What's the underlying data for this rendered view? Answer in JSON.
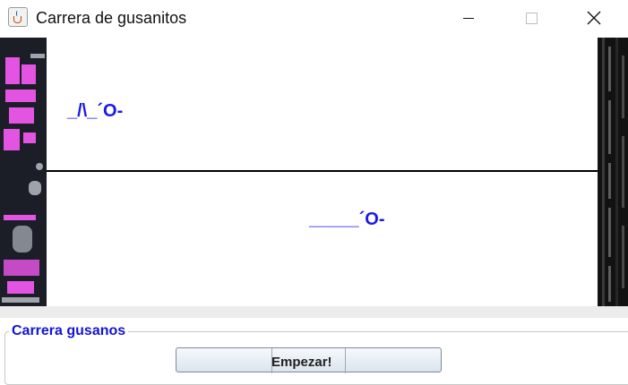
{
  "window": {
    "title": "Carrera de gusanitos",
    "icon": "java-cup-icon",
    "controls": {
      "minimize": "minimize-icon",
      "maximize": "maximize-icon",
      "close": "close-icon"
    }
  },
  "race": {
    "worms": [
      {
        "name": "worm-1",
        "text": "_/\\_´O-"
      },
      {
        "name": "worm-2",
        "text": "_____´O-"
      }
    ]
  },
  "panel": {
    "legend": "Carrera gusanos",
    "start_button": "Empezar!"
  },
  "colors": {
    "worm": "#1a1ae6",
    "legend": "#1313d6",
    "deco_left": "#1b1e27",
    "deco_magenta": "#e354e3",
    "deco_right": "#121212"
  }
}
